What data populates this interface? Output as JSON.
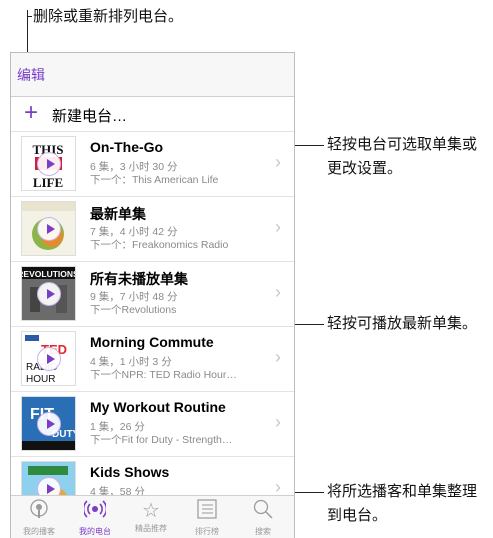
{
  "callouts": {
    "top": "删除或重新排列电台。",
    "right1_line1": "轻按电台可选取单集或",
    "right1_line2": "更改设置。",
    "right2": "轻按可播放最新单集。",
    "right3_line1": "将所选播客和单集整理",
    "right3_line2": "到电台。"
  },
  "navbar": {
    "edit_label": "编辑"
  },
  "new_station": {
    "plus": "+",
    "label": "新建电台…"
  },
  "stations": [
    {
      "title": "On-The-Go",
      "meta": "6 集，3 小时 30 分",
      "next": "下一个：This American Life",
      "art": "THIS AMERICAN LIFE"
    },
    {
      "title": "最新单集",
      "meta": "7 集，4 小时 42 分",
      "next": "下一个：Freakonomics Radio",
      "art": "FREAKONOMICS RADIO"
    },
    {
      "title": "所有未播放单集",
      "meta": "9 集，7 小时 48 分",
      "next": "下一个Revolutions",
      "art": "REVOLUTIONS"
    },
    {
      "title": "Morning Commute",
      "meta": "4 集，1 小时 3 分",
      "next": "下一个NPR: TED Radio Hour…",
      "art": "TED RADIO HOUR"
    },
    {
      "title": "My Workout Routine",
      "meta": "1 集，26 分",
      "next": "下一个Fit for Duty - Strength…",
      "art": "FIT FOR DUTY"
    },
    {
      "title": "Kids Shows",
      "meta": "4 集，58 分",
      "next": "",
      "art": "SESAME STREET"
    }
  ],
  "tabs": [
    {
      "label": "我的播客",
      "icon": "podcast-icon"
    },
    {
      "label": "我的电台",
      "icon": "station-icon"
    },
    {
      "label": "精品推荐",
      "icon": "star-icon"
    },
    {
      "label": "排行榜",
      "icon": "list-icon"
    },
    {
      "label": "搜索",
      "icon": "search-icon"
    }
  ],
  "colors": {
    "accent": "#7a3dc8"
  }
}
